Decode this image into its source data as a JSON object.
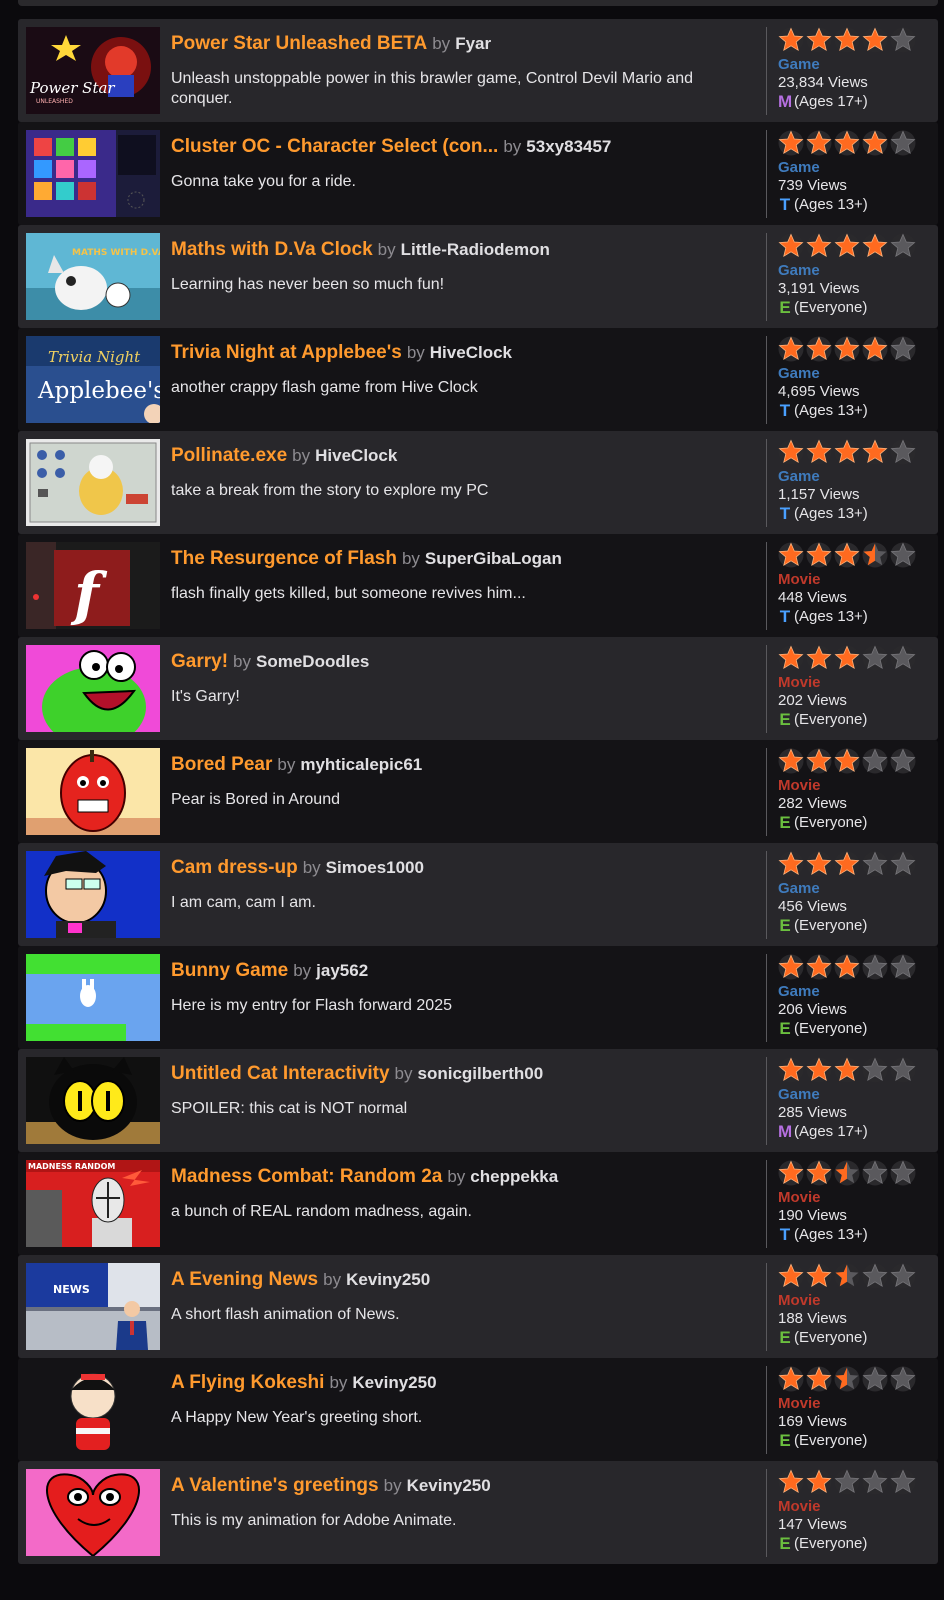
{
  "items": [
    {
      "title": "Power Star Unleashed BETA",
      "by": "by",
      "author": "Fyar",
      "description": "Unleash unstoppable power in this brawler game, Control Devil Mario and conquer.",
      "type": "Game",
      "type_color": "#3f7bbd",
      "views": "23,834 Views",
      "rating_letter": "M",
      "rating_text": "(Ages 17+)",
      "stars": 4,
      "thumb_text": "Power Star",
      "thumb_subtext": "UNLEASHED",
      "bg": "light"
    },
    {
      "title": "Cluster OC - Character Select (con...",
      "by": "by",
      "author": "53xy83457",
      "description": "Gonna take you for a ride.",
      "type": "Game",
      "type_color": "#3f7bbd",
      "views": "739 Views",
      "rating_letter": "T",
      "rating_text": "(Ages 13+)",
      "stars": 4,
      "bg": "dark"
    },
    {
      "title": "Maths with D.Va Clock",
      "by": "by",
      "author": "Little-Radiodemon",
      "description": "Learning has never been so much fun!",
      "type": "Game",
      "type_color": "#3f7bbd",
      "views": "3,191 Views",
      "rating_letter": "E",
      "rating_text": "(Everyone)",
      "stars": 4,
      "thumb_text": "MATHS WITH D.VA CLOCK",
      "bg": "light"
    },
    {
      "title": "Trivia Night at Applebee's",
      "by": "by",
      "author": "HiveClock",
      "description": "another crappy flash game from Hive Clock",
      "type": "Game",
      "type_color": "#3f7bbd",
      "views": "4,695 Views",
      "rating_letter": "T",
      "rating_text": "(Ages 13+)",
      "stars": 4,
      "thumb_text": "Trivia Night",
      "thumb_subtext": "Applebee's",
      "bg": "dark"
    },
    {
      "title": "Pollinate.exe",
      "by": "by",
      "author": "HiveClock",
      "description": "take a break from the story to explore my PC",
      "type": "Game",
      "type_color": "#3f7bbd",
      "views": "1,157 Views",
      "rating_letter": "T",
      "rating_text": "(Ages 13+)",
      "stars": 4,
      "bg": "light"
    },
    {
      "title": "The Resurgence of Flash",
      "by": "by",
      "author": "SuperGibaLogan",
      "description": "flash finally gets killed, but someone revives him...",
      "type": "Movie",
      "type_color": "#c0392b",
      "views": "448 Views",
      "rating_letter": "T",
      "rating_text": "(Ages 13+)",
      "stars": 3.5,
      "thumb_text": "f",
      "bg": "dark"
    },
    {
      "title": "Garry!",
      "by": "by",
      "author": "SomeDoodles",
      "description": "It's Garry!",
      "type": "Movie",
      "type_color": "#c0392b",
      "views": "202 Views",
      "rating_letter": "E",
      "rating_text": "(Everyone)",
      "stars": 3,
      "bg": "light"
    },
    {
      "title": "Bored Pear",
      "by": "by",
      "author": "myhticalepic61",
      "description": "Pear is Bored in Around",
      "type": "Movie",
      "type_color": "#c0392b",
      "views": "282 Views",
      "rating_letter": "E",
      "rating_text": "(Everyone)",
      "stars": 3,
      "bg": "dark"
    },
    {
      "title": "Cam dress-up",
      "by": "by",
      "author": "Simoes1000",
      "description": "I am cam, cam I am.",
      "type": "Game",
      "type_color": "#3f7bbd",
      "views": "456 Views",
      "rating_letter": "E",
      "rating_text": "(Everyone)",
      "stars": 3,
      "bg": "light"
    },
    {
      "title": "Bunny Game",
      "by": "by",
      "author": "jay562",
      "description": "Here is my entry for Flash forward 2025",
      "type": "Game",
      "type_color": "#3f7bbd",
      "views": "206 Views",
      "rating_letter": "E",
      "rating_text": "(Everyone)",
      "stars": 3,
      "bg": "dark"
    },
    {
      "title": "Untitled Cat Interactivity",
      "by": "by",
      "author": "sonicgilberth00",
      "description": "SPOILER: this cat is NOT normal",
      "type": "Game",
      "type_color": "#3f7bbd",
      "views": "285 Views",
      "rating_letter": "M",
      "rating_text": "(Ages 17+)",
      "stars": 3,
      "bg": "light"
    },
    {
      "title": "Madness Combat: Random 2a",
      "by": "by",
      "author": "cheppekka",
      "description": "a bunch of REAL random madness, again.",
      "type": "Movie",
      "type_color": "#c0392b",
      "views": "190 Views",
      "rating_letter": "T",
      "rating_text": "(Ages 13+)",
      "stars": 2.5,
      "thumb_text": "MADNESS RANDOM",
      "bg": "dark"
    },
    {
      "title": "A Evening News",
      "by": "by",
      "author": "Keviny250",
      "description": "A short flash animation of News.",
      "type": "Movie",
      "type_color": "#c0392b",
      "views": "188 Views",
      "rating_letter": "E",
      "rating_text": "(Everyone)",
      "stars": 2.5,
      "thumb_text": "NEWS",
      "bg": "light"
    },
    {
      "title": "A Flying Kokeshi",
      "by": "by",
      "author": "Keviny250",
      "description": "A Happy New Year's greeting short.",
      "type": "Movie",
      "type_color": "#c0392b",
      "views": "169 Views",
      "rating_letter": "E",
      "rating_text": "(Everyone)",
      "stars": 2.5,
      "bg": "dark"
    },
    {
      "title": "A Valentine's greetings",
      "by": "by",
      "author": "Keviny250",
      "description": "This is my animation for Adobe Animate.",
      "type": "Movie",
      "type_color": "#c0392b",
      "views": "147 Views",
      "rating_letter": "E",
      "rating_text": "(Everyone)",
      "stars": 2,
      "bg": "light"
    }
  ]
}
